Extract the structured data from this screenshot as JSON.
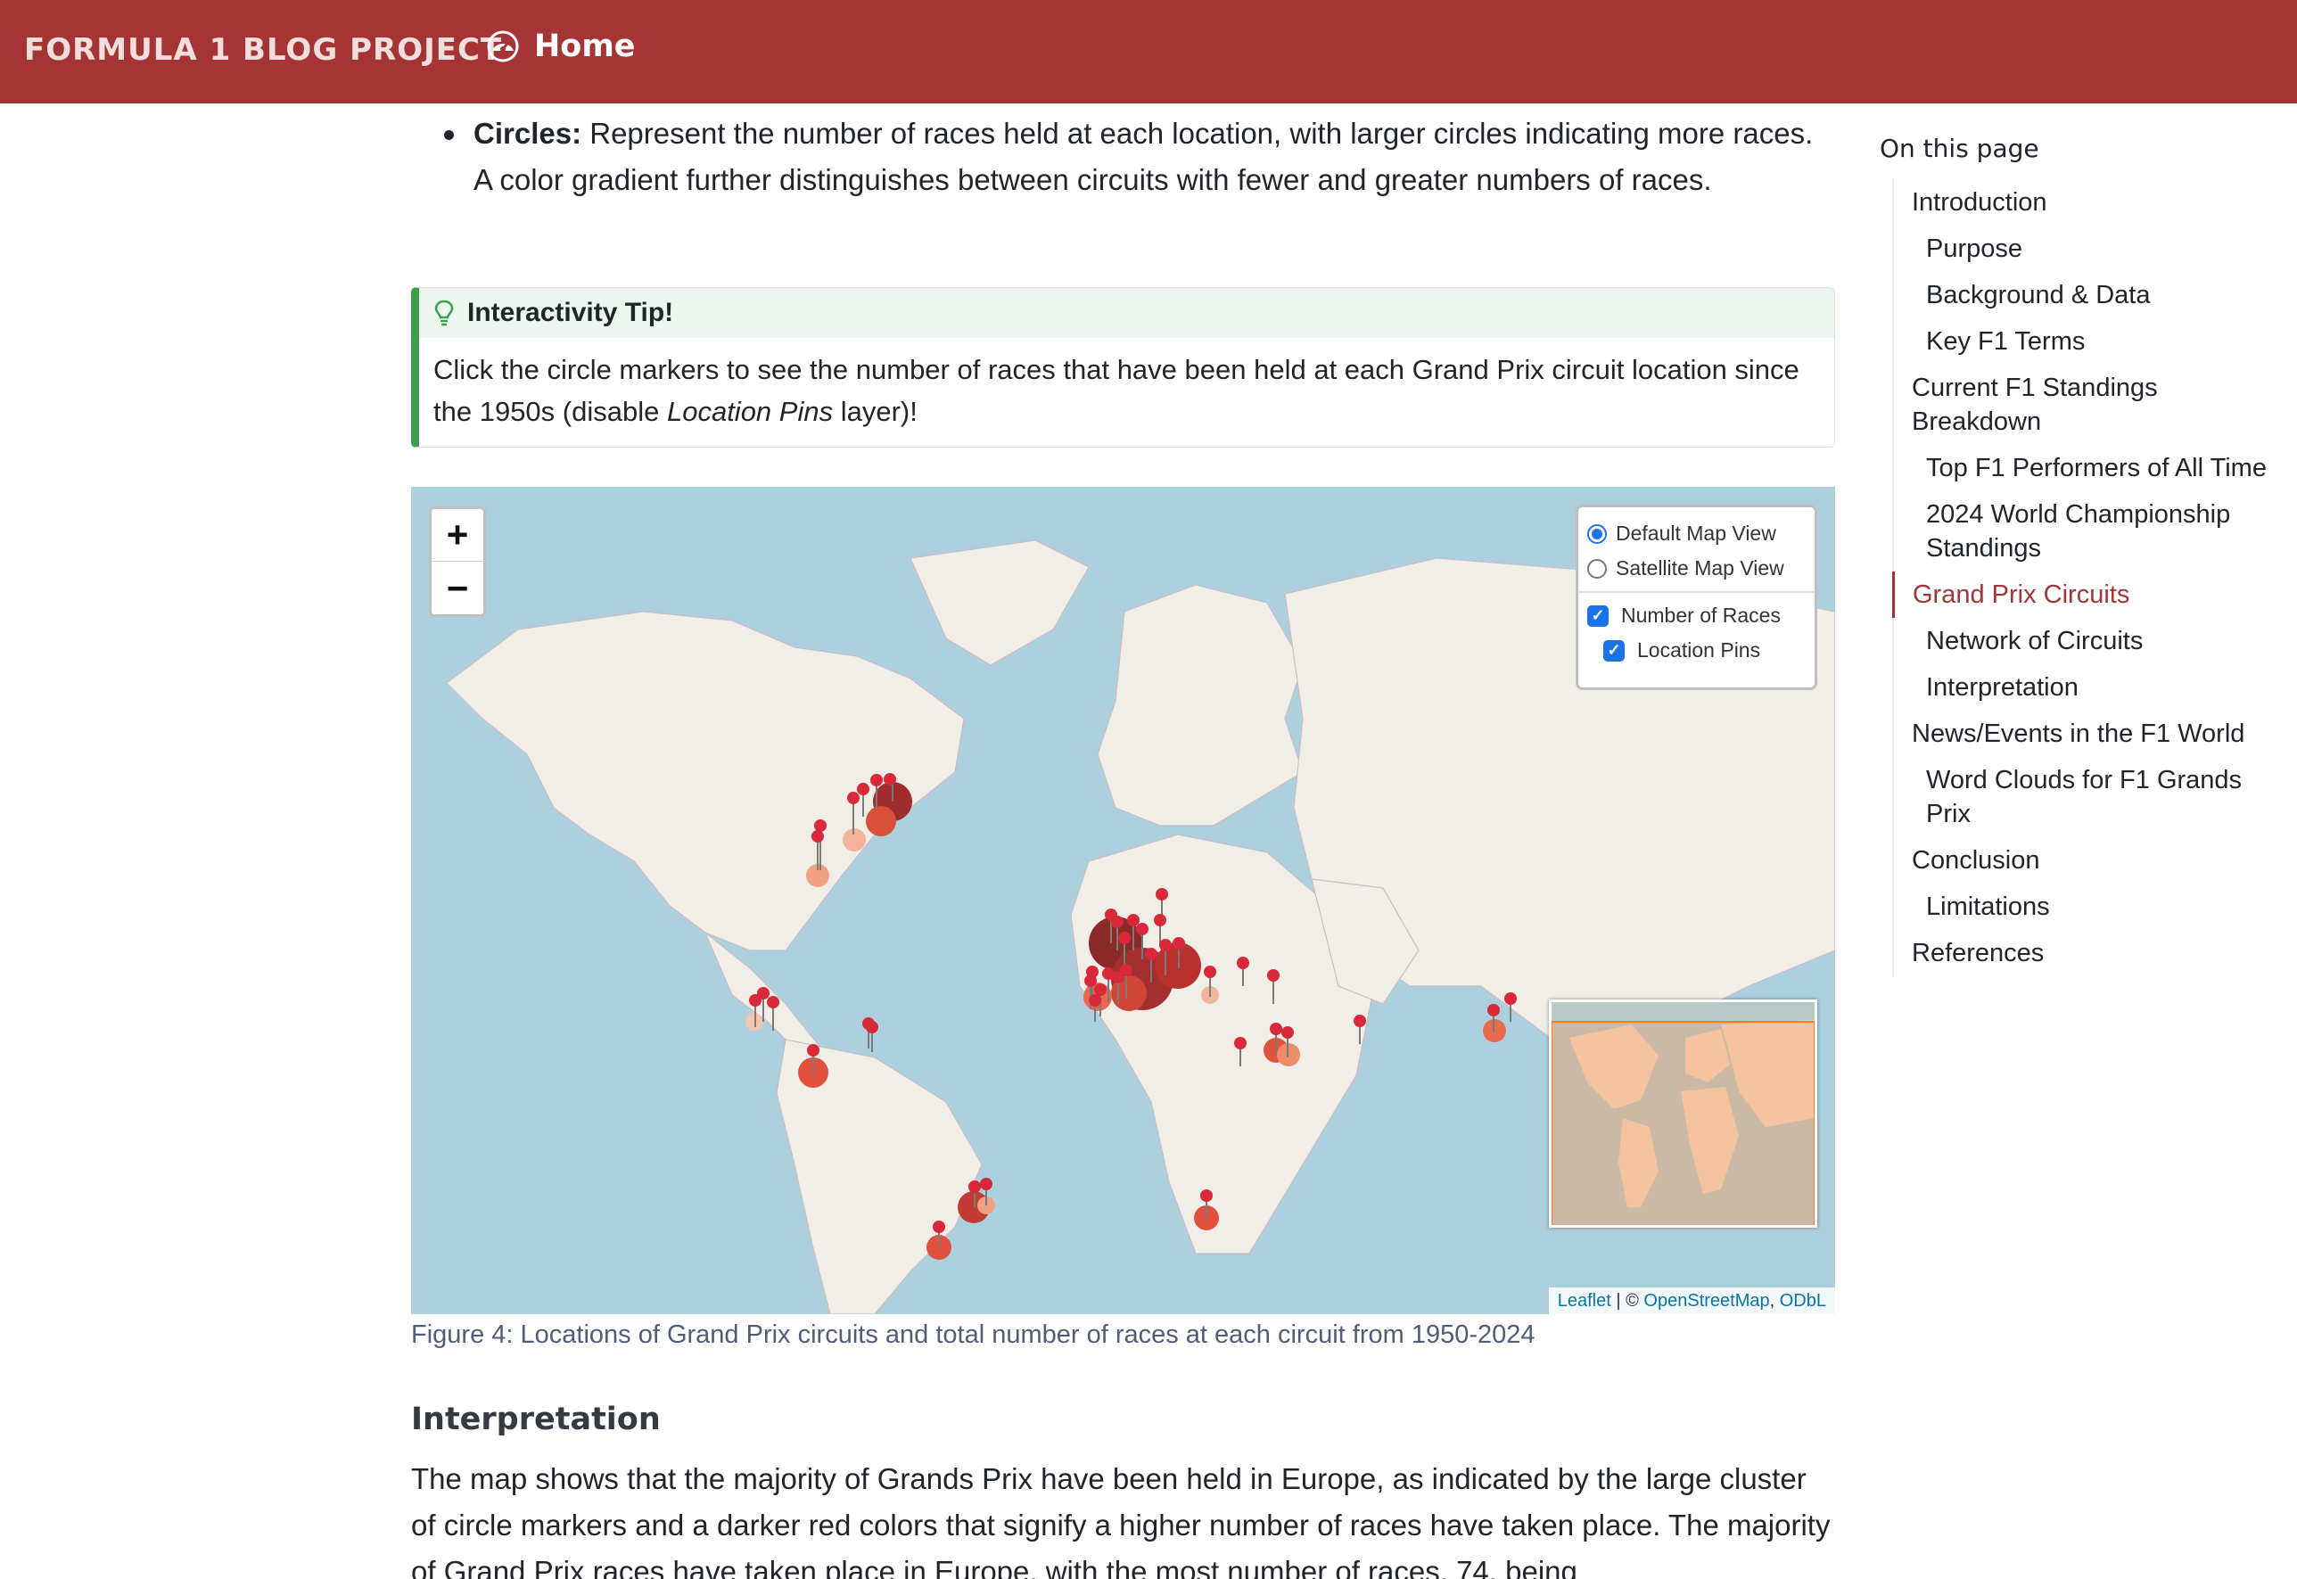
{
  "navbar": {
    "brand": "FORMULA 1 BLOG PROJECT",
    "home_label": "Home",
    "home_icon": "speedometer-icon",
    "background": "#a53535"
  },
  "content": {
    "bullet_term": "Circles:",
    "bullet_text": " Represent the number of races held at each location, with larger circles indicating more races. A color gradient further distinguishes between circuits with fewer and greater numbers of races.",
    "callout": {
      "title": "Interactivity Tip!",
      "icon": "lightbulb-icon",
      "text_before": "Click the circle markers to see the number of races that have been held at each Grand Prix circuit location since the 1950s (disable ",
      "text_italic": "Location Pins",
      "text_after": " layer)!",
      "accent": "#3aa14a"
    },
    "map": {
      "zoom_in": "+",
      "zoom_out": "−",
      "base_layers": [
        {
          "label": "Default Map View",
          "selected": true
        },
        {
          "label": "Satellite Map View",
          "selected": false
        }
      ],
      "overlays": [
        {
          "label": "Number of Races",
          "checked": true
        },
        {
          "label": "Location Pins",
          "checked": true
        }
      ],
      "attribution": {
        "leaflet": "Leaflet",
        "sep": " | © ",
        "osm": "OpenStreetMap",
        "comma": ", ",
        "odbl": "ODbL"
      }
    },
    "caption": "Figure 4: Locations of Grand Prix circuits and total number of races at each circuit from 1950-2024",
    "interpretation_heading": "Interpretation",
    "interpretation_text": "The map shows that the majority of Grands Prix have been held in Europe, as indicated by the large cluster of circle markers and a darker red colors that signify a higher number of races have taken place. The majority of Grand Prix races have taken place in Europe, with the most number of races, 74, being"
  },
  "toc": {
    "title": "On this page",
    "items": [
      {
        "label": "Introduction",
        "level": 1,
        "active": false
      },
      {
        "label": "Purpose",
        "level": 2,
        "active": false
      },
      {
        "label": "Background & Data",
        "level": 2,
        "active": false
      },
      {
        "label": "Key F1 Terms",
        "level": 2,
        "active": false
      },
      {
        "label": "Current F1 Standings Breakdown",
        "level": 1,
        "active": false
      },
      {
        "label": "Top F1 Performers of All Time",
        "level": 2,
        "active": false
      },
      {
        "label": "2024 World Championship Standings",
        "level": 2,
        "active": false
      },
      {
        "label": "Grand Prix Circuits",
        "level": 1,
        "active": true
      },
      {
        "label": "Network of Circuits",
        "level": 2,
        "active": false
      },
      {
        "label": "Interpretation",
        "level": 2,
        "active": false
      },
      {
        "label": "News/Events in the F1 World",
        "level": 1,
        "active": false
      },
      {
        "label": "Word Clouds for F1 Grands Prix",
        "level": 2,
        "active": false
      },
      {
        "label": "Conclusion",
        "level": 1,
        "active": false
      },
      {
        "label": "Limitations",
        "level": 2,
        "active": false
      },
      {
        "label": "References",
        "level": 1,
        "active": false
      }
    ]
  }
}
